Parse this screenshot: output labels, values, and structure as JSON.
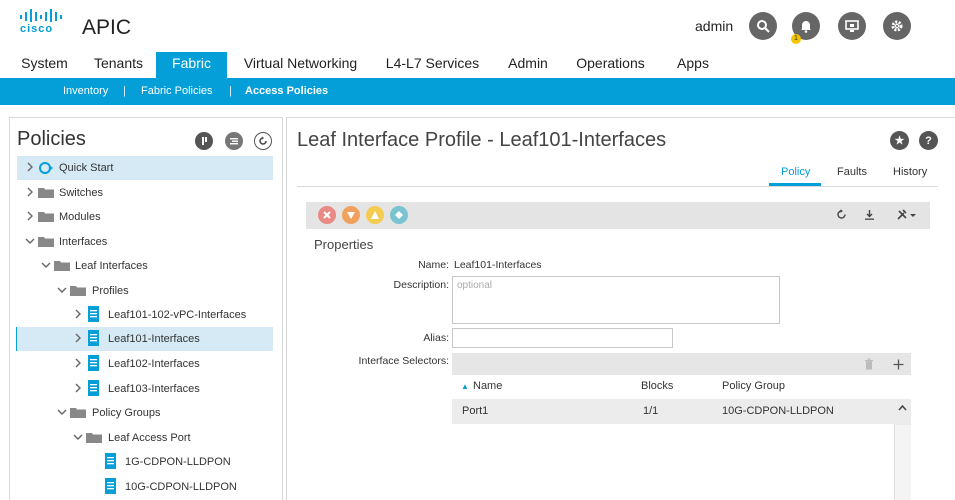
{
  "brand": {
    "logo_text": "cisco",
    "app_title": "APIC",
    "accent_color": "#049fd9"
  },
  "header": {
    "user": "admin",
    "icons": [
      "search-icon",
      "bell-icon",
      "monitor-icon",
      "gear-icon"
    ],
    "notification_count": "1"
  },
  "tabs": [
    {
      "label": "System"
    },
    {
      "label": "Tenants"
    },
    {
      "label": "Fabric",
      "active": true
    },
    {
      "label": "Virtual Networking"
    },
    {
      "label": "L4-L7 Services"
    },
    {
      "label": "Admin"
    },
    {
      "label": "Operations"
    },
    {
      "label": "Apps"
    }
  ],
  "subnav": {
    "items": [
      "Inventory",
      "Fabric Policies",
      "Access Policies"
    ],
    "separator": "|",
    "active": "Access Policies"
  },
  "left_panel": {
    "title": "Policies",
    "tree": [
      {
        "label": "Quick Start",
        "icon": "quick-start-icon"
      },
      {
        "label": "Switches",
        "icon": "folder-icon"
      },
      {
        "label": "Modules",
        "icon": "folder-icon"
      },
      {
        "label": "Interfaces",
        "icon": "folder-icon",
        "expanded": true
      },
      {
        "label": "Leaf Interfaces",
        "icon": "folder-icon",
        "expanded": true
      },
      {
        "label": "Profiles",
        "icon": "folder-icon",
        "expanded": true
      },
      {
        "label": "Leaf101-102-vPC-Interfaces",
        "icon": "document-icon"
      },
      {
        "label": "Leaf101-Interfaces",
        "icon": "document-icon",
        "selected": true
      },
      {
        "label": "Leaf102-Interfaces",
        "icon": "document-icon"
      },
      {
        "label": "Leaf103-Interfaces",
        "icon": "document-icon"
      },
      {
        "label": "Policy Groups",
        "icon": "folder-icon",
        "expanded": true
      },
      {
        "label": "Leaf Access Port",
        "icon": "folder-icon",
        "expanded": true
      },
      {
        "label": "1G-CDPON-LLDPON",
        "icon": "document-icon"
      },
      {
        "label": "10G-CDPON-LLDPON",
        "icon": "document-icon"
      }
    ]
  },
  "main": {
    "title": "Leaf Interface Profile - Leaf101-Interfaces",
    "tabs": [
      {
        "label": "Policy",
        "active": true
      },
      {
        "label": "Faults"
      },
      {
        "label": "History"
      }
    ],
    "section": "Properties",
    "fields": {
      "name_label": "Name:",
      "name_value": "Leaf101-Interfaces",
      "description_label": "Description:",
      "description_placeholder": "optional",
      "alias_label": "Alias:",
      "alias_value": "",
      "selectors_label": "Interface Selectors:"
    },
    "table": {
      "columns": [
        "Name",
        "Blocks",
        "Policy Group"
      ],
      "sort_indicator": "▲",
      "rows": [
        {
          "name": "Port1",
          "blocks": "1/1",
          "policy_group": "10G-CDPON-LLDPON"
        }
      ]
    },
    "fault_colors": [
      "#ea8a85",
      "#f0a15e",
      "#f5cc52",
      "#79c4d0"
    ]
  }
}
